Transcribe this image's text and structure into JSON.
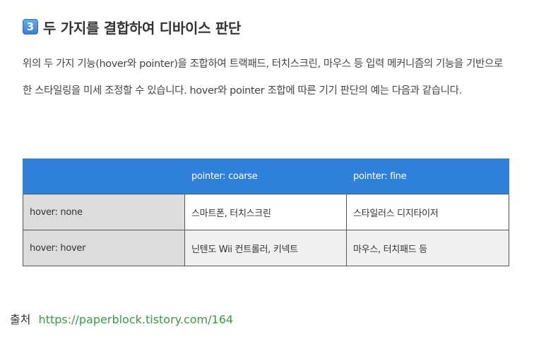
{
  "heading": {
    "number": "3",
    "title": "두 가지를 결합하여 디바이스 판단"
  },
  "paragraph": "위의 두 가지 기능(hover와 pointer)을 조합하여 트랙패드, 터치스크린, 마우스 등 입력 메커니즘의 기능을 기반으로 한 스타일링을 미세 조정할 수 있습니다. hover와 pointer 조합에 따른 기기 판단의 예는 다음과 같습니다.",
  "table": {
    "headers": [
      "",
      "pointer: coarse",
      "pointer: fine"
    ],
    "rows": [
      [
        "hover: none",
        "스마트폰, 터치스크린",
        "스타일러스 디지타이저"
      ],
      [
        "hover: hover",
        "닌텐도 Wii 컨트롤러, 키넥트",
        "마우스, 터치패드 등"
      ]
    ]
  },
  "source": {
    "label": "출처",
    "link": "https://paperblock.tistory.com/164"
  },
  "colors": {
    "header_bg": "#2f80d9",
    "row_head_bg": "#dcdcdc",
    "link": "#3a9a46"
  }
}
